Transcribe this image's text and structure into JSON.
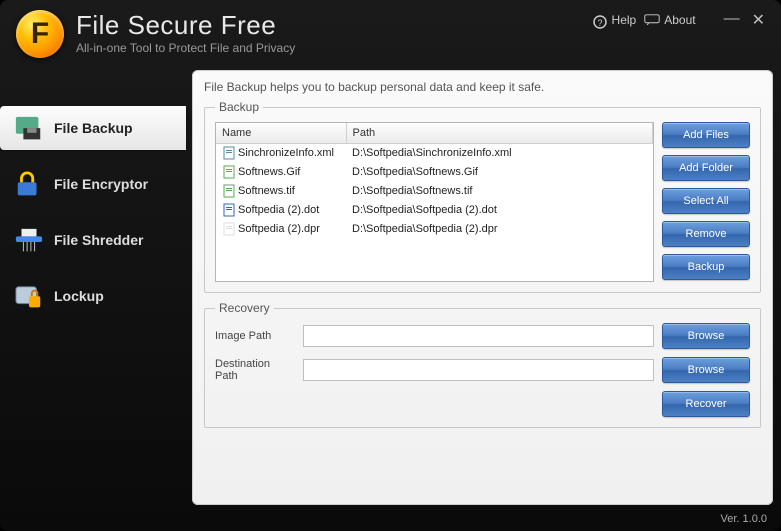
{
  "header": {
    "title": "File Secure Free",
    "subtitle": "All-in-one Tool to Protect File and Privacy",
    "help": "Help",
    "about": "About"
  },
  "sidebar": {
    "items": [
      {
        "label": "File Backup"
      },
      {
        "label": "File Encryptor"
      },
      {
        "label": "File Shredder"
      },
      {
        "label": "Lockup"
      }
    ]
  },
  "panel": {
    "description": "File Backup helps you to backup personal data and keep it safe.",
    "backup_legend": "Backup",
    "recovery_legend": "Recovery",
    "table": {
      "col_name": "Name",
      "col_path": "Path",
      "rows": [
        {
          "name": "SinchronizeInfo.xml",
          "path": "D:\\Softpedia\\SinchronizeInfo.xml"
        },
        {
          "name": "Softnews.Gif",
          "path": "D:\\Softpedia\\Softnews.Gif"
        },
        {
          "name": "Softnews.tif",
          "path": "D:\\Softpedia\\Softnews.tif"
        },
        {
          "name": "Softpedia (2).dot",
          "path": "D:\\Softpedia\\Softpedia (2).dot"
        },
        {
          "name": "Softpedia (2).dpr",
          "path": "D:\\Softpedia\\Softpedia (2).dpr"
        }
      ]
    },
    "buttons": {
      "add_files": "Add Files",
      "add_folder": "Add Folder",
      "select_all": "Select All",
      "remove": "Remove",
      "backup": "Backup",
      "browse": "Browse",
      "recover": "Recover"
    },
    "recovery": {
      "image_path_label": "Image Path",
      "dest_path_label": "Destination Path",
      "image_path_value": "",
      "dest_path_value": ""
    }
  },
  "footer": {
    "version": "Ver. 1.0.0"
  }
}
